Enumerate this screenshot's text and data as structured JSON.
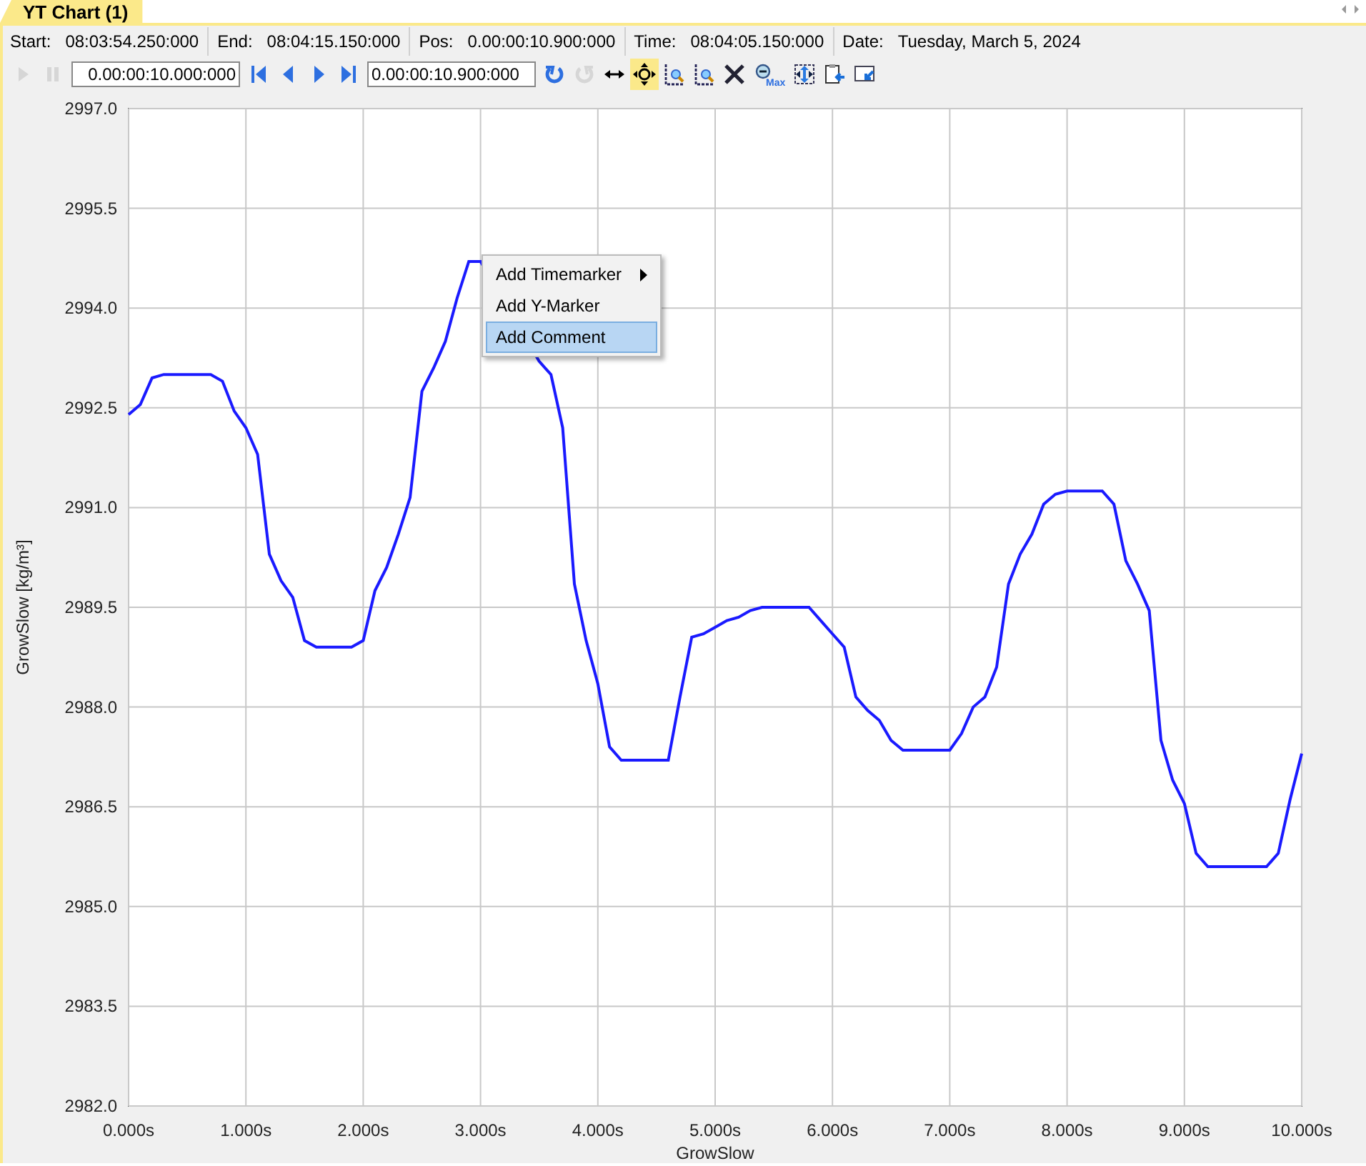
{
  "tab": {
    "label": "YT Chart (1)",
    "selected": true
  },
  "info": [
    {
      "label": "Start:",
      "value": "08:03:54.250:000"
    },
    {
      "label": "End:",
      "value": "08:04:15.150:000"
    },
    {
      "label": "Pos:",
      "value": "0.00:00:10.900:000"
    },
    {
      "label": "Time:",
      "value": "08:04:05.150:000"
    },
    {
      "label": "Date:",
      "value": "Tuesday, March 5, 2024"
    }
  ],
  "toolbar": [
    {
      "kind": "play",
      "disabled": true,
      "selected": false
    },
    {
      "kind": "pause",
      "disabled": true,
      "selected": false
    },
    {
      "kind": "field",
      "value": "0.00:00:10.000:000"
    },
    {
      "kind": "first",
      "disabled": false,
      "selected": false
    },
    {
      "kind": "prev",
      "disabled": false,
      "selected": false
    },
    {
      "kind": "next",
      "disabled": false,
      "selected": false
    },
    {
      "kind": "last",
      "disabled": false,
      "selected": false
    },
    {
      "kind": "field",
      "value": "0.00:00:10.900:000"
    },
    {
      "kind": "undo",
      "disabled": false,
      "selected": false
    },
    {
      "kind": "redo",
      "disabled": true,
      "selected": false
    },
    {
      "kind": "pan",
      "disabled": false,
      "selected": false
    },
    {
      "kind": "move",
      "disabled": false,
      "selected": true
    },
    {
      "kind": "zoom-x",
      "disabled": false,
      "selected": false
    },
    {
      "kind": "zoom-y",
      "disabled": false,
      "selected": false
    },
    {
      "kind": "clear",
      "disabled": false,
      "selected": false
    },
    {
      "kind": "zoom-max",
      "label": "Max",
      "disabled": false,
      "selected": false
    },
    {
      "kind": "fit",
      "disabled": false,
      "selected": false
    },
    {
      "kind": "copy",
      "disabled": false,
      "selected": false
    },
    {
      "kind": "export",
      "disabled": false,
      "selected": false
    }
  ],
  "chart": {
    "chart_data": {
      "type": "line",
      "xlabel": "GrowSlow",
      "ylabel": "GrowSlow [kg/m³]",
      "x": [
        0,
        0.1,
        0.2,
        0.3,
        0.4,
        0.5,
        0.6,
        0.7,
        0.8,
        0.9,
        1,
        1.1,
        1.2,
        1.3,
        1.4,
        1.5,
        1.6,
        1.7,
        1.8,
        1.9,
        2,
        2.1,
        2.2,
        2.3,
        2.4,
        2.5,
        2.6,
        2.7,
        2.8,
        2.9,
        3,
        3.5,
        3.6,
        3.7,
        3.8,
        3.9,
        4,
        4.1,
        4.2,
        4.3,
        4.4,
        4.5,
        4.6,
        4.7,
        4.8,
        4.9,
        5,
        5.1,
        5.2,
        5.3,
        5.4,
        5.5,
        5.6,
        5.7,
        5.8,
        5.9,
        6,
        6.1,
        6.2,
        6.3,
        6.4,
        6.5,
        6.6,
        6.7,
        6.8,
        6.9,
        7,
        7.1,
        7.2,
        7.3,
        7.4,
        7.5,
        7.6,
        7.7,
        7.8,
        7.9,
        8,
        8.1,
        8.2,
        8.3,
        8.4,
        8.5,
        8.6,
        8.7,
        8.8,
        8.9,
        9,
        9.1,
        9.2,
        9.3,
        9.4,
        9.5,
        9.6,
        9.7,
        9.8,
        9.9,
        10
      ],
      "series": [
        {
          "color": "#1a1aff",
          "values": [
            2992.4,
            2992.55,
            2992.95,
            2993.0,
            2993.0,
            2993.0,
            2993.0,
            2993.0,
            2992.9,
            2992.45,
            2992.2,
            2991.8,
            2990.3,
            2989.9,
            2989.65,
            2989.0,
            2988.9,
            2988.9,
            2988.9,
            2988.9,
            2989.0,
            2989.75,
            2990.1,
            2990.6,
            2991.15,
            2992.75,
            2993.1,
            2993.5,
            2994.15,
            2994.7,
            2994.7,
            2993.2,
            2993.0,
            2992.2,
            2989.85,
            2989.0,
            2988.35,
            2987.4,
            2987.2,
            2987.2,
            2987.2,
            2987.2,
            2987.2,
            2988.15,
            2989.05,
            2989.1,
            2989.2,
            2989.3,
            2989.35,
            2989.45,
            2989.5,
            2989.5,
            2989.5,
            2989.5,
            2989.5,
            2989.3,
            2989.1,
            2988.9,
            2988.15,
            2987.95,
            2987.8,
            2987.5,
            2987.35,
            2987.35,
            2987.35,
            2987.35,
            2987.35,
            2987.6,
            2988.0,
            2988.15,
            2988.6,
            2989.85,
            2990.3,
            2990.6,
            2991.05,
            2991.2,
            2991.25,
            2991.25,
            2991.25,
            2991.25,
            2991.05,
            2990.2,
            2989.85,
            2989.45,
            2987.5,
            2986.9,
            2986.55,
            2985.8,
            2985.6,
            2985.6,
            2985.6,
            2985.6,
            2985.6,
            2985.6,
            2985.8,
            2986.6,
            2987.3
          ]
        }
      ],
      "grid": true,
      "xlim": [
        0,
        10
      ],
      "ylim": [
        2982,
        2997
      ],
      "xticks": [
        {
          "value": 0,
          "label": "0.000s"
        },
        {
          "value": 1,
          "label": "1.000s"
        },
        {
          "value": 2,
          "label": "2.000s"
        },
        {
          "value": 3,
          "label": "3.000s"
        },
        {
          "value": 4,
          "label": "4.000s"
        },
        {
          "value": 5,
          "label": "5.000s"
        },
        {
          "value": 6,
          "label": "6.000s"
        },
        {
          "value": 7,
          "label": "7.000s"
        },
        {
          "value": 8,
          "label": "8.000s"
        },
        {
          "value": 9,
          "label": "9.000s"
        },
        {
          "value": 10,
          "label": "10.000s"
        }
      ],
      "yticks": [
        {
          "value": 2982,
          "label": "2982.0"
        },
        {
          "value": 2983.5,
          "label": "2983.5"
        },
        {
          "value": 2985,
          "label": "2985.0"
        },
        {
          "value": 2986.5,
          "label": "2986.5"
        },
        {
          "value": 2988,
          "label": "2988.0"
        },
        {
          "value": 2989.5,
          "label": "2989.5"
        },
        {
          "value": 2991,
          "label": "2991.0"
        },
        {
          "value": 2992.5,
          "label": "2992.5"
        },
        {
          "value": 2994,
          "label": "2994.0"
        },
        {
          "value": 2995.5,
          "label": "2995.5"
        },
        {
          "value": 2997,
          "label": "2997.0"
        }
      ]
    }
  },
  "context_menu": [
    {
      "label": "Add Timemarker",
      "submenu": true,
      "selected": false
    },
    {
      "label": "Add Y-Marker",
      "submenu": false,
      "selected": false
    },
    {
      "label": "Add Comment",
      "submenu": false,
      "selected": true
    }
  ]
}
